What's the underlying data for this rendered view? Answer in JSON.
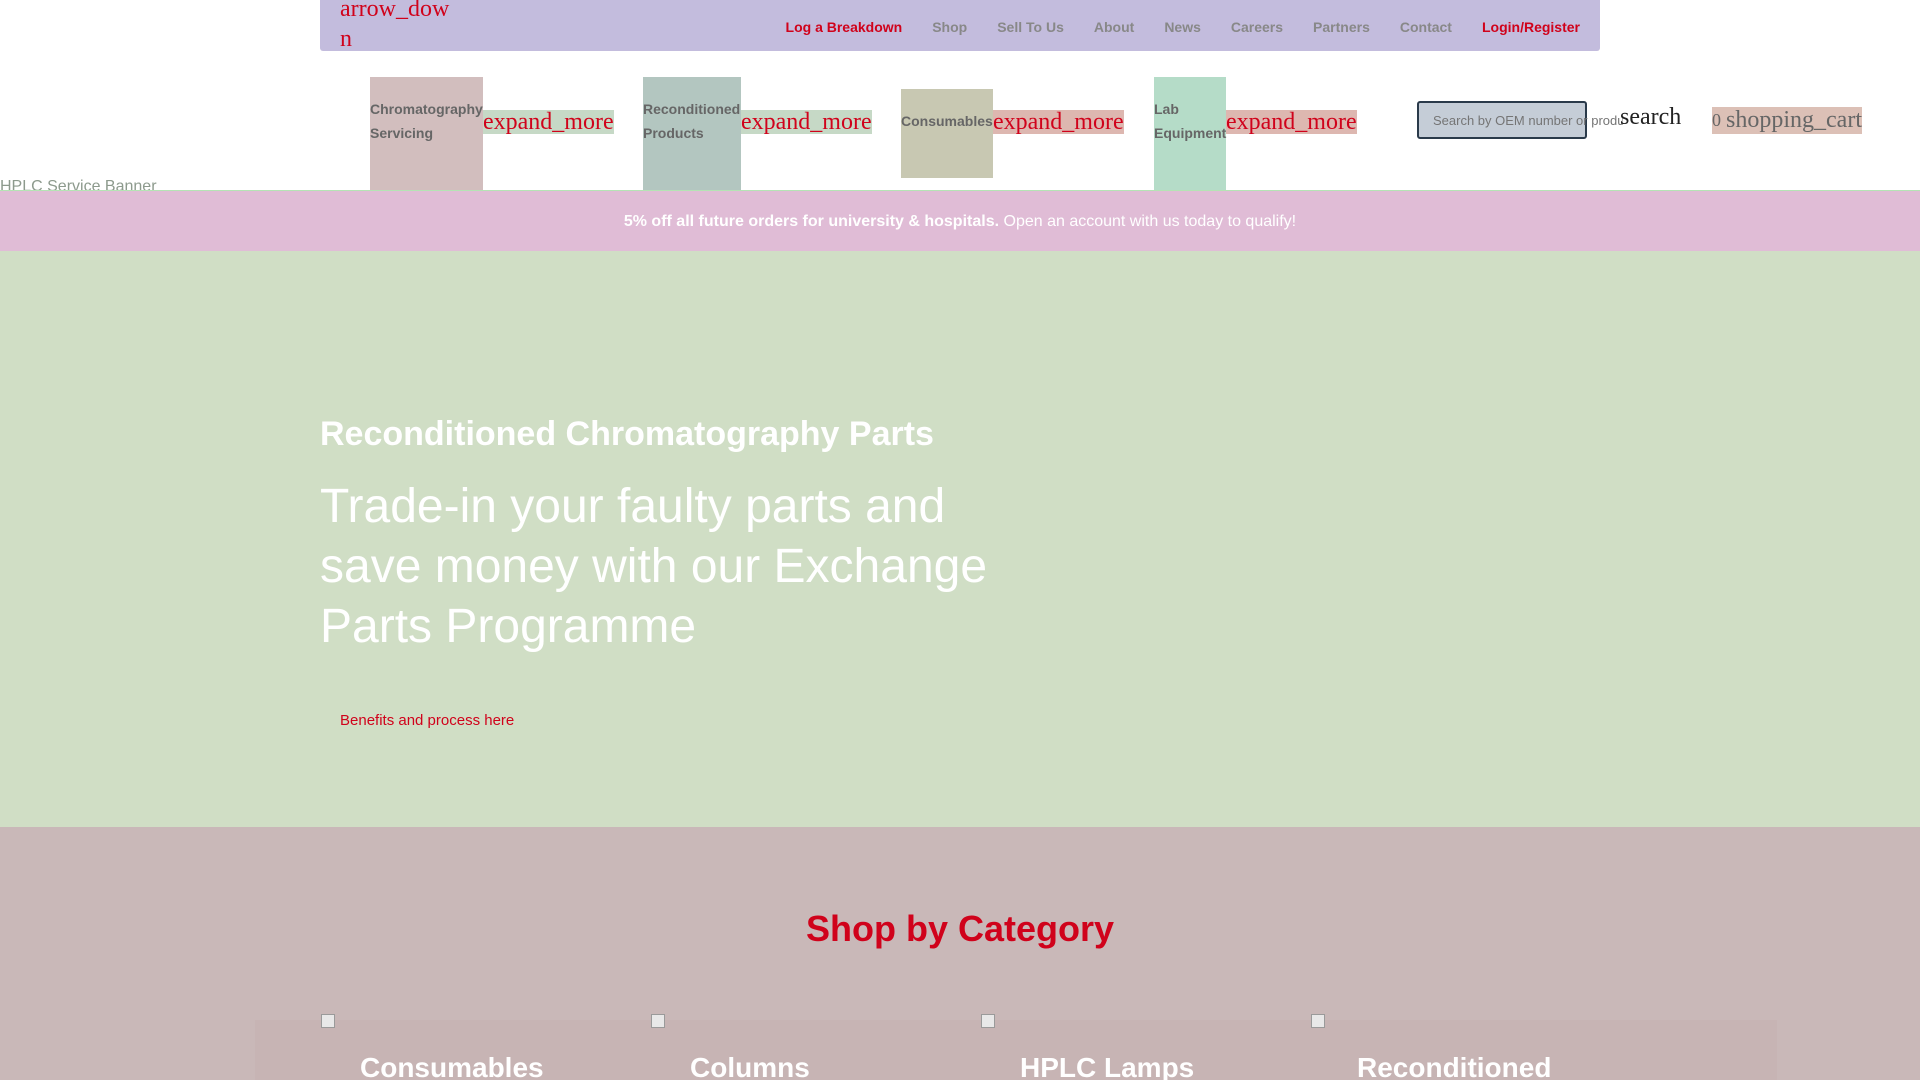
{
  "topbar": {
    "left_icon": "arrow_down",
    "nav": [
      {
        "label": "Log a Breakdown",
        "highlight": true
      },
      {
        "label": "Shop",
        "highlight": false
      },
      {
        "label": "Sell To Us",
        "highlight": false
      },
      {
        "label": "About",
        "highlight": false
      },
      {
        "label": "News",
        "highlight": false
      },
      {
        "label": "Careers",
        "highlight": false
      },
      {
        "label": "Partners",
        "highlight": false
      },
      {
        "label": "Contact",
        "highlight": false
      },
      {
        "label": "Login/Register",
        "highlight": true
      }
    ]
  },
  "main_nav": {
    "items": [
      {
        "label": "Chromatography Servicing",
        "expand_icon": "expand_more"
      },
      {
        "label": "Reconditioned Products",
        "expand_icon": "expand_more"
      },
      {
        "label": "Consumables",
        "expand_icon": "expand_more"
      },
      {
        "label": "Lab Equipment",
        "expand_icon": "expand_more"
      }
    ],
    "search": {
      "placeholder": "Search by OEM number or product",
      "icon": "search"
    },
    "cart": {
      "count": "0",
      "icon": "shopping_cart"
    }
  },
  "broken_image_alt": "HPLC Service Banner",
  "promo": {
    "bold": "5% off all future orders for university & hospitals.",
    "text": " Open an account with us today to qualify!"
  },
  "hero": {
    "kicker": "Reconditioned Chromatography Parts",
    "title": "Trade-in your faulty parts and save money with our Exchange Parts Programme",
    "link": "Benefits and process here"
  },
  "categories": {
    "heading": "Shop by Category",
    "items": [
      {
        "name": "Consumables"
      },
      {
        "name": "Columns"
      },
      {
        "name": "HPLC Lamps"
      },
      {
        "name": "Reconditioned"
      }
    ]
  },
  "colors": {
    "accent": "#d0021b",
    "topbar": "#c3bcdd",
    "promo": "#e0bcd6",
    "hero": "#d0dec5",
    "categories_bg": "#c9b8b8"
  }
}
